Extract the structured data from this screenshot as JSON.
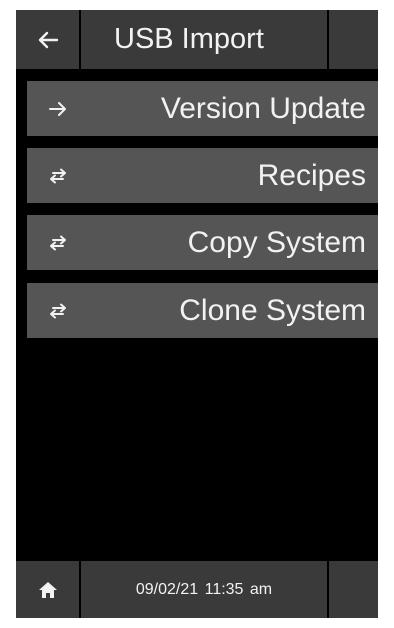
{
  "header": {
    "title": "USB Import",
    "back_icon": "arrow-left-icon"
  },
  "menu": {
    "items": [
      {
        "label": "Version Update",
        "icon": "arrow-right-icon"
      },
      {
        "label": "Recipes",
        "icon": "swap-arrows-icon"
      },
      {
        "label": "Copy System",
        "icon": "swap-arrows-icon"
      },
      {
        "label": "Clone System",
        "icon": "swap-arrows-icon"
      }
    ]
  },
  "footer": {
    "datetime": "09/02/21  11:35 am",
    "home_icon": "home-icon"
  },
  "colors": {
    "background": "#000000",
    "bar": "#3a3a3a",
    "button": "#555555",
    "text": "#f2f2f2"
  }
}
